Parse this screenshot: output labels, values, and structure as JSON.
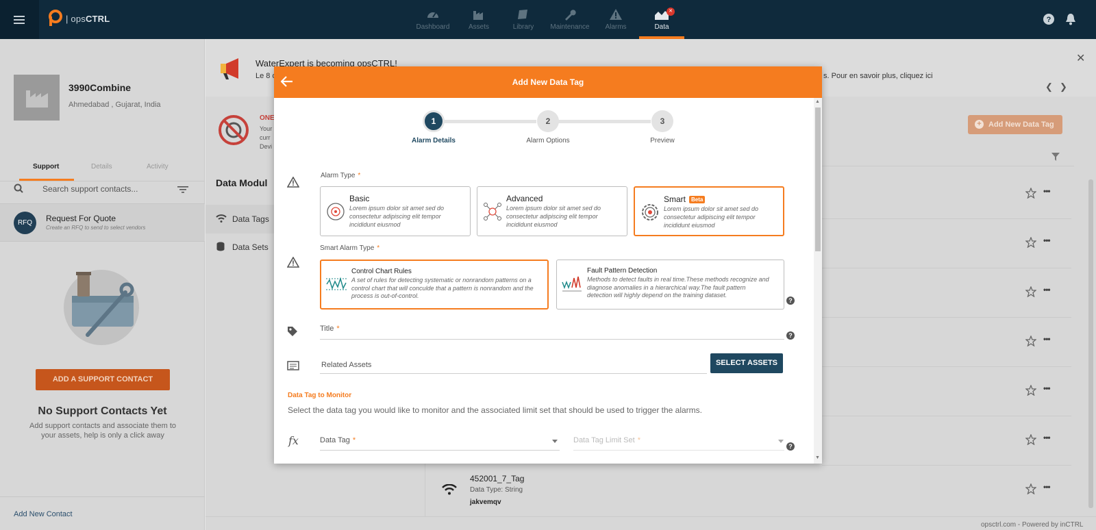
{
  "app": {
    "logo_text_light": "ops",
    "logo_text_bold": "CTRL"
  },
  "nav": {
    "items": [
      {
        "label": "Dashboard",
        "icon": "dashboard-icon"
      },
      {
        "label": "Assets",
        "icon": "factory-icon"
      },
      {
        "label": "Library",
        "icon": "book-icon"
      },
      {
        "label": "Maintenance",
        "icon": "wrench-icon"
      },
      {
        "label": "Alarms",
        "icon": "warning-icon"
      },
      {
        "label": "Data",
        "icon": "chart-icon"
      }
    ],
    "active": "Data"
  },
  "org": {
    "name": "3990Combine",
    "location": "Ahmedabad , Gujarat, India"
  },
  "left_tabs": [
    "Support",
    "Details",
    "Activity"
  ],
  "support": {
    "search_placeholder": "Search support contacts...",
    "rfq_avatar": "RFQ",
    "rfq_title": "Request For Quote",
    "rfq_subtitle": "Create an RFQ to send to select vendors",
    "add_button": "ADD A SUPPORT CONTACT",
    "empty_title": "No Support Contacts Yet",
    "empty_desc": "Add support contacts and associate them to your assets, help is only a click away",
    "add_new_contact": "Add New Contact"
  },
  "banner": {
    "title": "WaterExpert is becoming opsCTRL!",
    "text_left": "Le 8 d",
    "text_right": "s. Pour en savoir plus, cliquez ici"
  },
  "notice": {
    "label": "ONE",
    "line1": "Your",
    "line2": "curr",
    "line3": "Devi"
  },
  "main": {
    "add_button": "Add New Data Tag",
    "modules_title": "Data Modul",
    "datatags_label": "Data Tags",
    "datasets_label": "Data Sets"
  },
  "tag_row": {
    "name": "452001_7_Tag",
    "type": "Data Type: String",
    "value": "jakvemqv"
  },
  "footer": {
    "powered": "opsctrl.com - Powered by inCTRL"
  },
  "modal": {
    "title": "Add New Data Tag",
    "steps": [
      {
        "num": "1",
        "label": "Alarm Details"
      },
      {
        "num": "2",
        "label": "Alarm Options"
      },
      {
        "num": "3",
        "label": "Preview"
      }
    ],
    "alarm_type_label": "Alarm Type",
    "alarm_types": [
      {
        "title": "Basic",
        "desc": "Lorem ipsum dolor sit amet sed do consectetur adipiscing elit tempor incididunt eiusmod"
      },
      {
        "title": "Advanced",
        "desc": "Lorem ipsum dolor sit amet sed do consectetur adipiscing elit tempor incididunt eiusmod"
      },
      {
        "title": "Smart",
        "badge": "Beta",
        "desc": "Lorem ipsum dolor sit amet sed do consectetur adipiscing elit tempor incididunt eiusmod"
      }
    ],
    "smart_type_label": "Smart Alarm Type",
    "smart_types": [
      {
        "title": "Control Chart Rules",
        "desc": "A set of rules for detecting systematic or nonrandom patterns on a control chart that will conculde that a pattern is nonrandom and the process is out-of-control."
      },
      {
        "title": "Fault Pattern Detection",
        "desc": "Methods to detect faults in real time.These methods recognize and diagnose anomalies in a hierarchical way.The fault pattern detection will highly depend on the training dataset."
      }
    ],
    "title_label": "Title",
    "related_assets_label": "Related Assets",
    "select_assets": "SELECT ASSETS",
    "section_title": "Data Tag to Monitor",
    "section_desc": "Select the data tag you would like to monitor and the associated limit set that should be used to trigger the alarms.",
    "data_tag_label": "Data Tag",
    "limit_set_label": "Data Tag Limit Set"
  },
  "colors": {
    "accent": "#f57c1f",
    "navy": "#1f4860",
    "topbar": "#0f2a3c"
  }
}
